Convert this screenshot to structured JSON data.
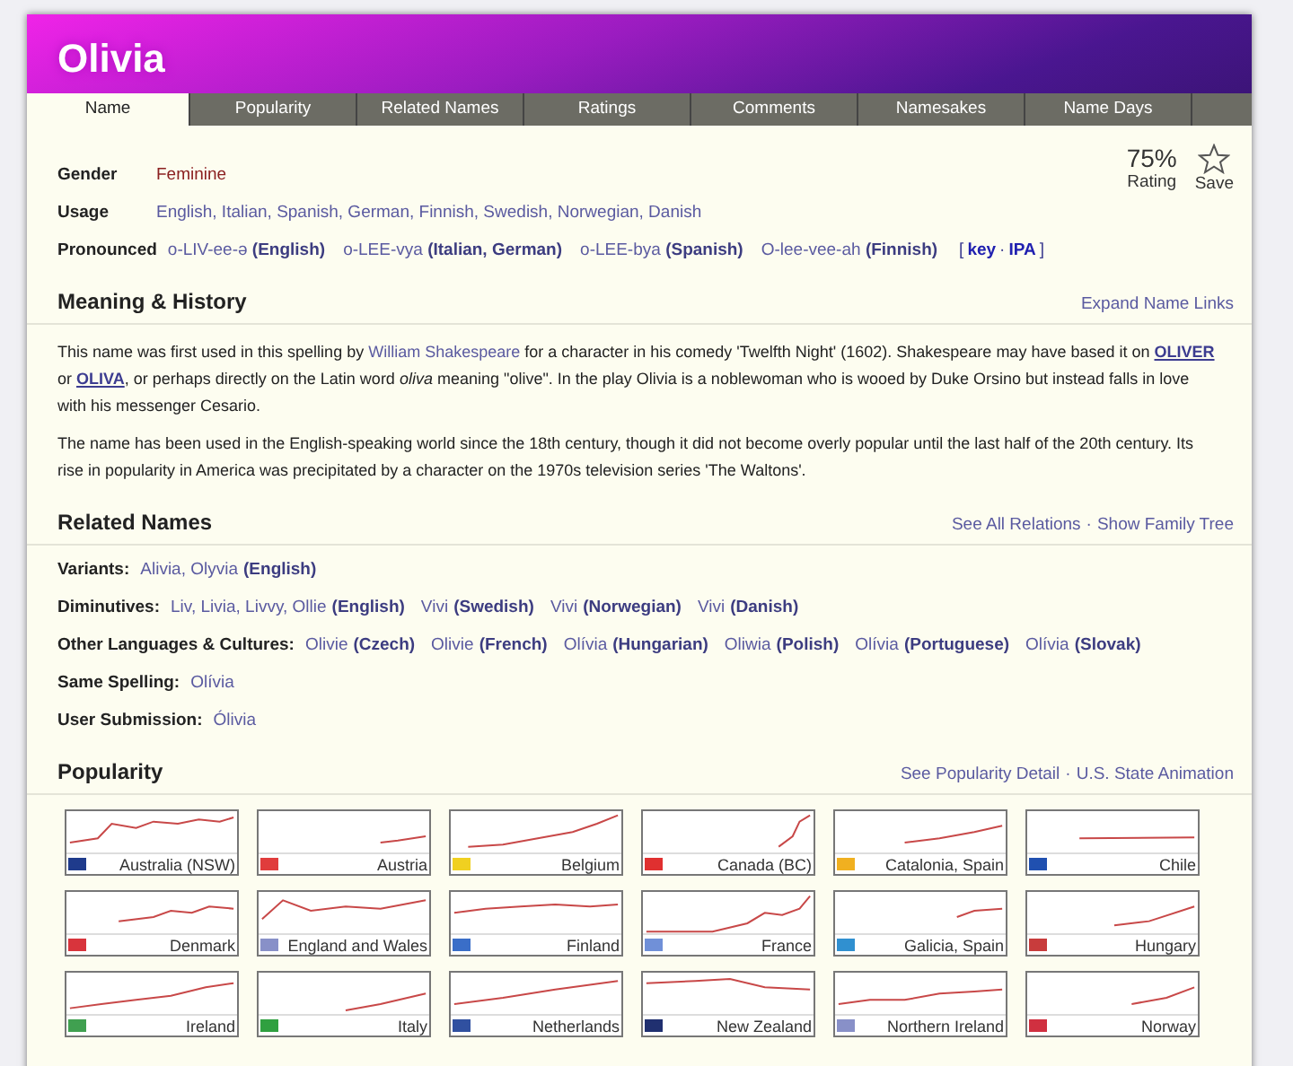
{
  "title": "Olivia",
  "tabs": [
    {
      "label": "Name",
      "selected": true
    },
    {
      "label": "Popularity",
      "selected": false
    },
    {
      "label": "Related Names",
      "selected": false
    },
    {
      "label": "Ratings",
      "selected": false
    },
    {
      "label": "Comments",
      "selected": false
    },
    {
      "label": "Namesakes",
      "selected": false
    },
    {
      "label": "Name Days",
      "selected": false
    }
  ],
  "rating": {
    "value": "75%",
    "label": "Rating"
  },
  "save": {
    "label": "Save"
  },
  "facts": [
    {
      "kind": "gender",
      "label": "Gender",
      "value": "Feminine"
    },
    {
      "kind": "usage",
      "label": "Usage",
      "value": "English, Italian, Spanish, German, Finnish, Swedish, Norwegian, Danish"
    }
  ],
  "pronounced": {
    "label": "Pronounced",
    "items": [
      {
        "text": "o-LIV-ee-ə",
        "lang": "(English)"
      },
      {
        "text": "o-LEE-vya",
        "lang": "(Italian, German)"
      },
      {
        "text": "o-LEE-bya",
        "lang": "(Spanish)"
      },
      {
        "text": "O-lee-vee-ah",
        "lang": "(Finnish)"
      }
    ],
    "key": {
      "open": "[",
      "key": "key",
      "sep": "·",
      "ipa": "IPA",
      "close": "]"
    }
  },
  "meaning": {
    "heading": "Meaning & History",
    "links": [
      "Expand Name Links"
    ],
    "paragraphs": [
      [
        {
          "kind": "text",
          "text": "This name was first used in this spelling by "
        },
        {
          "kind": "link",
          "text": "William Shakespeare"
        },
        {
          "kind": "text",
          "text": " for a character in his comedy 'Twelfth Night' (1602). Shakespeare may have based it on "
        },
        {
          "kind": "strong-link",
          "text": "OLIVER"
        },
        {
          "kind": "text",
          "text": " or "
        },
        {
          "kind": "strong-link",
          "text": "OLIVA"
        },
        {
          "kind": "text",
          "text": ", or perhaps directly on the Latin word *oliva* meaning \"olive\". In the play Olivia is a noblewoman who is wooed by Duke Orsino but instead falls in love with his messenger Cesario."
        }
      ],
      [
        {
          "kind": "text",
          "text": "The name has been used in the English-speaking world since the 18th century, though it did not become overly popular until the last half of the 20th century. Its rise in popularity in America was precipitated by a character on the 1970s television series 'The Waltons'."
        }
      ]
    ]
  },
  "related": {
    "heading": "Related Names",
    "links": [
      "See All Relations",
      "Show Family Tree"
    ],
    "sep": "·",
    "rows": [
      {
        "label": "Variants:",
        "groups": [
          {
            "names": "Alivia, Olyvia",
            "lang": "(English)"
          }
        ]
      },
      {
        "label": "Diminutives:",
        "groups": [
          {
            "names": "Liv, Livia, Livvy, Ollie",
            "lang": "(English)"
          },
          {
            "names": "Vivi",
            "lang": "(Swedish)"
          },
          {
            "names": "Vivi",
            "lang": "(Norwegian)"
          },
          {
            "names": "Vivi",
            "lang": "(Danish)"
          }
        ]
      },
      {
        "label": "Other Languages & Cultures:",
        "groups": [
          {
            "names": "Olivie",
            "lang": "(Czech)"
          },
          {
            "names": "Olivie",
            "lang": "(French)"
          },
          {
            "names": "Olívia",
            "lang": "(Hungarian)"
          },
          {
            "names": "Oliwia",
            "lang": "(Polish)"
          },
          {
            "names": "Olívia",
            "lang": "(Portuguese)"
          },
          {
            "names": "Olívia",
            "lang": "(Slovak)"
          }
        ]
      },
      {
        "label": "Same Spelling:",
        "groups": [
          {
            "names": "Olívia"
          }
        ]
      },
      {
        "label": "User Submission:",
        "groups": [
          {
            "names": "Ólivia"
          }
        ]
      }
    ]
  },
  "popularity": {
    "heading": "Popularity",
    "links": [
      "See Popularity Detail",
      "U.S. State Animation"
    ],
    "sep": "·",
    "regions": [
      {
        "name": "Australia (NSW)",
        "color": "#1f3b8c"
      },
      {
        "name": "Austria",
        "color": "#e03c3c"
      },
      {
        "name": "Belgium",
        "color": "#f0d020"
      },
      {
        "name": "Canada (BC)",
        "color": "#e03030"
      },
      {
        "name": "Catalonia, Spain",
        "color": "#f0b020"
      },
      {
        "name": "Chile",
        "color": "#2050b0"
      },
      {
        "name": "Denmark",
        "color": "#d8343c"
      },
      {
        "name": "England and Wales",
        "color": "#8890c8"
      },
      {
        "name": "Finland",
        "color": "#3a6ec8"
      },
      {
        "name": "France",
        "color": "#7090d8"
      },
      {
        "name": "Galicia, Spain",
        "color": "#3090d0"
      },
      {
        "name": "Hungary",
        "color": "#c83c3c"
      },
      {
        "name": "Ireland",
        "color": "#40a050"
      },
      {
        "name": "Italy",
        "color": "#30a040"
      },
      {
        "name": "Netherlands",
        "color": "#3050a0"
      },
      {
        "name": "New Zealand",
        "color": "#203070"
      },
      {
        "name": "Northern Ireland",
        "color": "#8890c8"
      },
      {
        "name": "Norway",
        "color": "#d03040"
      }
    ]
  }
}
